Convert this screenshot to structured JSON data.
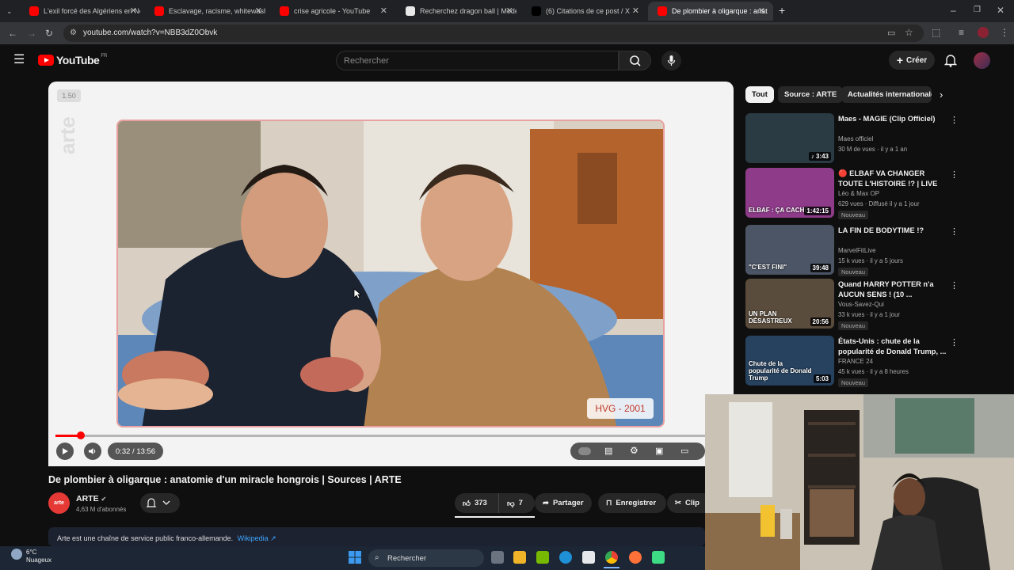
{
  "browser": {
    "tabs": [
      {
        "label": "L'exil forcé des Algériens en No",
        "favicon_color": "#ff0000"
      },
      {
        "label": "Esclavage, racisme, whitewashin",
        "favicon_color": "#ff0000"
      },
      {
        "label": "crise agricole - YouTube",
        "favicon_color": "#ff0000"
      },
      {
        "label": "Recherchez dragon ball | Mode",
        "favicon_color": "#e8e8e8"
      },
      {
        "label": "(6) Citations de ce post / X",
        "favicon_color": "#000000"
      },
      {
        "label": "De plombier à oligarque : anat",
        "favicon_color": "#ff0000",
        "active": true
      }
    ],
    "url": "youtube.com/watch?v=NBB3dZ0Obvk"
  },
  "youtube": {
    "logo_text": "YouTube",
    "region": "FR",
    "search_placeholder": "Rechercher",
    "create_label": "Créer"
  },
  "player": {
    "speed_badge": "1.50",
    "watermark": "arte",
    "caption_badge": "HVG - 2001",
    "time": "0:32 / 13:56",
    "progress_fraction": 0.039
  },
  "video": {
    "title": "De plombier à oligarque : anatomie d'un miracle hongrois | Sources | ARTE",
    "channel": "ARTE",
    "channel_avatar_text": "arte",
    "subscribers": "4,63 M d'abonnés",
    "likes": "373",
    "dislikes": "7",
    "share": "Partager",
    "save": "Enregistrer",
    "clip": "Clip",
    "description": "Arte est une chaîne de service public franco-allemande.",
    "description_link": "Wikipedia ↗"
  },
  "sidebar": {
    "chips": [
      "Tout",
      "Source : ARTE",
      "Actualités internationale"
    ],
    "recommendations": [
      {
        "title": "Maes - MAGIE (Clip Officiel)",
        "channel": "Maes officiel",
        "meta": "30 M de vues · il y a 1 an",
        "duration": "♪ 3:43",
        "badge": "",
        "thumb_color": "#2b3b44"
      },
      {
        "title": "🔴 ELBAF VA CHANGER TOUTE L'HISTOIRE !? | LIVE THÉORIE...",
        "channel": "Léo & Max OP",
        "meta": "629 vues · Diffusé il y a 1 jour",
        "duration": "1:42:15",
        "badge": "Nouveau",
        "thumb_color": "#8e3b8a",
        "thumb_text": "ELBAF : ÇA CACHE"
      },
      {
        "title": "LA FIN DE BODYTIME !?",
        "channel": "MarvelFitLive",
        "meta": "15 k vues · il y a 5 jours",
        "duration": "39:48",
        "badge": "Nouveau",
        "thumb_color": "#4b5565",
        "thumb_text": "\"C'EST FINI\""
      },
      {
        "title": "Quand HARRY POTTER n'a AUCUN SENS ! (10 ...",
        "channel": "Vous-Savez-Qui",
        "meta": "33 k vues · il y a 1 jour",
        "duration": "20:56",
        "badge": "Nouveau",
        "thumb_color": "#5a4c3c",
        "thumb_text": "UN PLAN DÉSASTREUX"
      },
      {
        "title": "États-Unis : chute de la popularité de Donald Trump, ...",
        "channel": "FRANCE 24",
        "meta": "45 k vues · il y a 8 heures",
        "duration": "5:03",
        "badge": "Nouveau",
        "thumb_color": "#27425f",
        "thumb_text": "Chute de la popularité de Donald Trump"
      }
    ]
  },
  "taskbar": {
    "temperature": "6°C",
    "weather": "Nuageux",
    "search_label": "Rechercher"
  }
}
